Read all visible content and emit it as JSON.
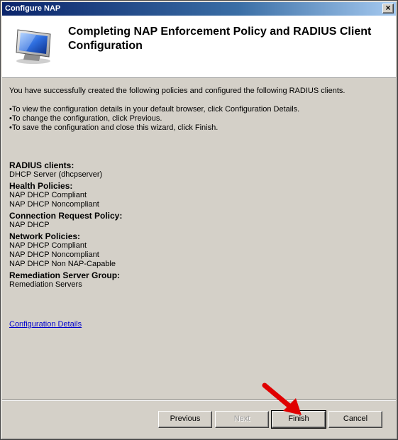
{
  "window": {
    "title": "Configure NAP",
    "close_label": "×"
  },
  "header": {
    "title": "Completing NAP Enforcement Policy and RADIUS Client Configuration",
    "icon": "computer-monitor-icon"
  },
  "intro": "You have successfully created the following policies and configured the following RADIUS clients.",
  "bullets": [
    "To view the configuration details in your default browser, click Configuration Details.",
    "To change the configuration, click Previous.",
    "To save the configuration and close this wizard, click Finish."
  ],
  "summary": [
    {
      "heading": "RADIUS clients:",
      "items": [
        "DHCP Server (dhcpserver)"
      ]
    },
    {
      "heading": "Health Policies:",
      "items": [
        "NAP DHCP Compliant",
        "NAP DHCP Noncompliant"
      ]
    },
    {
      "heading": "Connection Request Policy:",
      "items": [
        "NAP DHCP"
      ]
    },
    {
      "heading": "Network Policies:",
      "items": [
        "NAP DHCP Compliant",
        "NAP DHCP Noncompliant",
        "NAP DHCP Non NAP-Capable"
      ]
    },
    {
      "heading": "Remediation Server Group:",
      "items": [
        "Remediation Servers"
      ]
    }
  ],
  "details_link": "Configuration Details",
  "buttons": {
    "previous": "Previous",
    "next": "Next",
    "finish": "Finish",
    "cancel": "Cancel"
  },
  "annotation": {
    "icon": "red-arrow-icon",
    "color": "#e00000"
  }
}
